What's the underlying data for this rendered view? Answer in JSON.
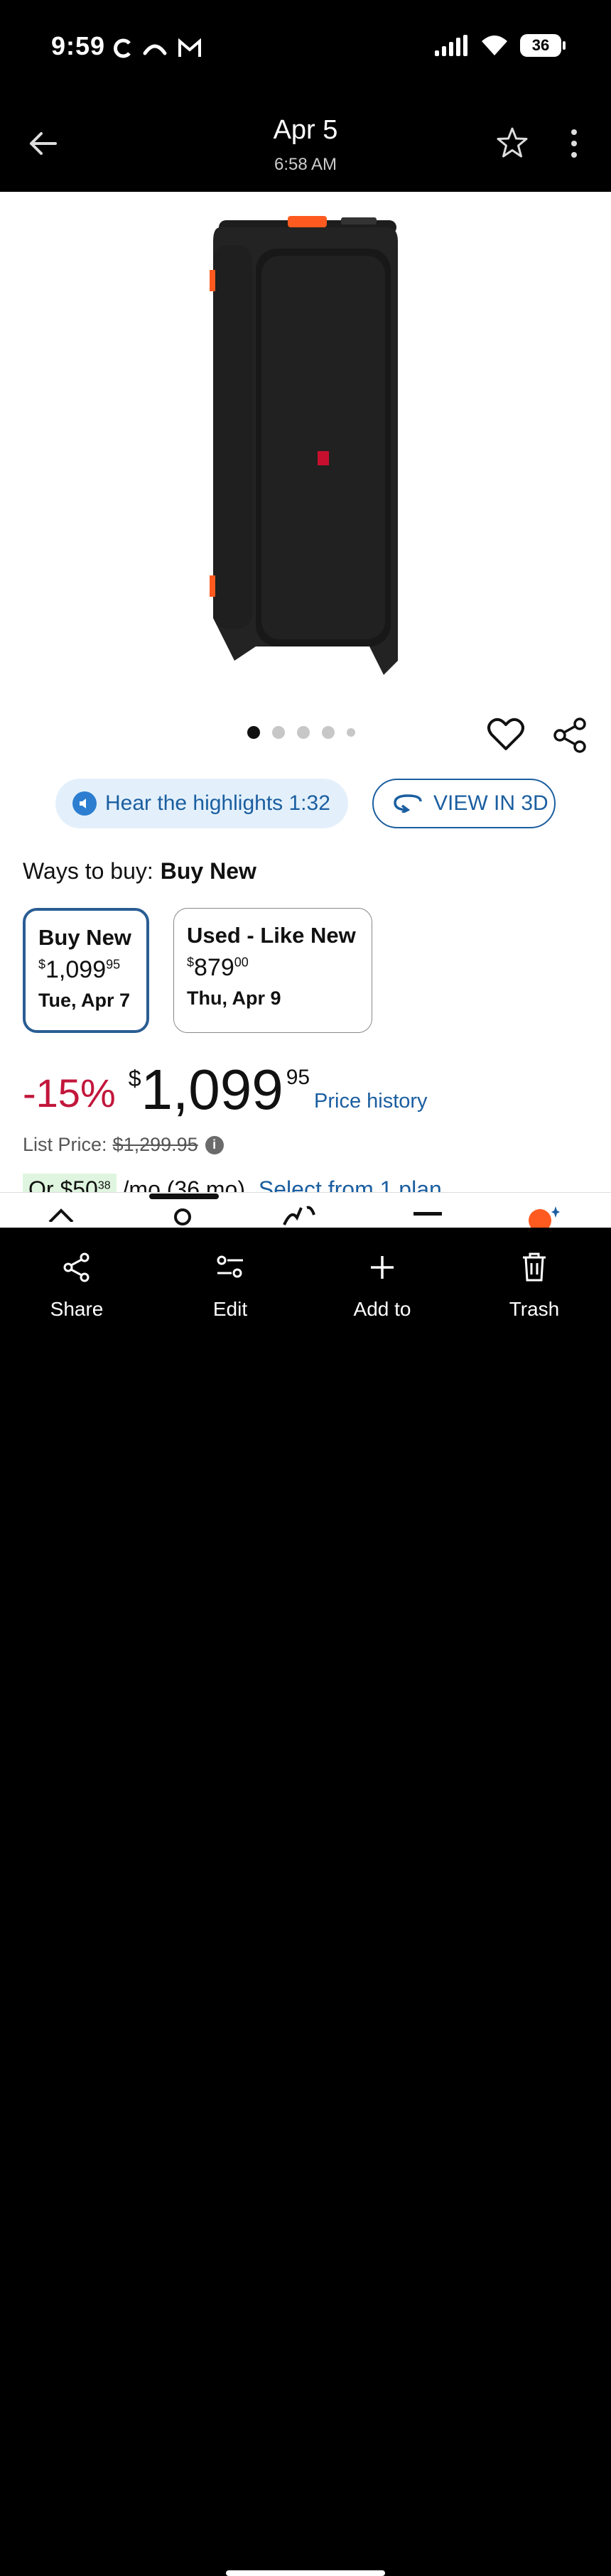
{
  "status_bar": {
    "time": "9:59",
    "battery": "36"
  },
  "app_bar": {
    "date": "Apr 5",
    "time": "6:58 AM"
  },
  "gallery": {
    "dot_count": 5,
    "active_index": 0
  },
  "actions": {
    "hear_label": "Hear the highlights 1:32",
    "view3d_label": "VIEW IN 3D"
  },
  "ways_to_buy": {
    "label": "Ways to buy:",
    "selected": "Buy New",
    "options": [
      {
        "title": "Buy New",
        "price_currency": "$",
        "price_main": "1,099",
        "price_cents": "95",
        "date": "Tue, Apr 7"
      },
      {
        "title": "Used - Like New",
        "price_currency": "$",
        "price_main": "879",
        "price_cents": "00",
        "date": "Thu, Apr 9"
      }
    ]
  },
  "price": {
    "discount": "-15%",
    "currency": "$",
    "amount": "1,099",
    "cents": "95",
    "history_label": "Price history",
    "list_price_label": "List Price:",
    "list_price": "$1,299.95",
    "plan_prefix": "Or $50",
    "plan_cents": "38",
    "plan_suffix": "/mo (36 mo)",
    "plan_link": "Select from 1 plan"
  },
  "bottom_bar": {
    "items": [
      {
        "label": "Share",
        "icon": "share-icon"
      },
      {
        "label": "Edit",
        "icon": "edit-icon"
      },
      {
        "label": "Add to",
        "icon": "plus-icon"
      },
      {
        "label": "Trash",
        "icon": "trash-icon"
      }
    ]
  },
  "colors": {
    "accent_blue": "#1b5ea0",
    "discount_red": "#c2163b",
    "brand_orange": "#ff5a1f"
  }
}
